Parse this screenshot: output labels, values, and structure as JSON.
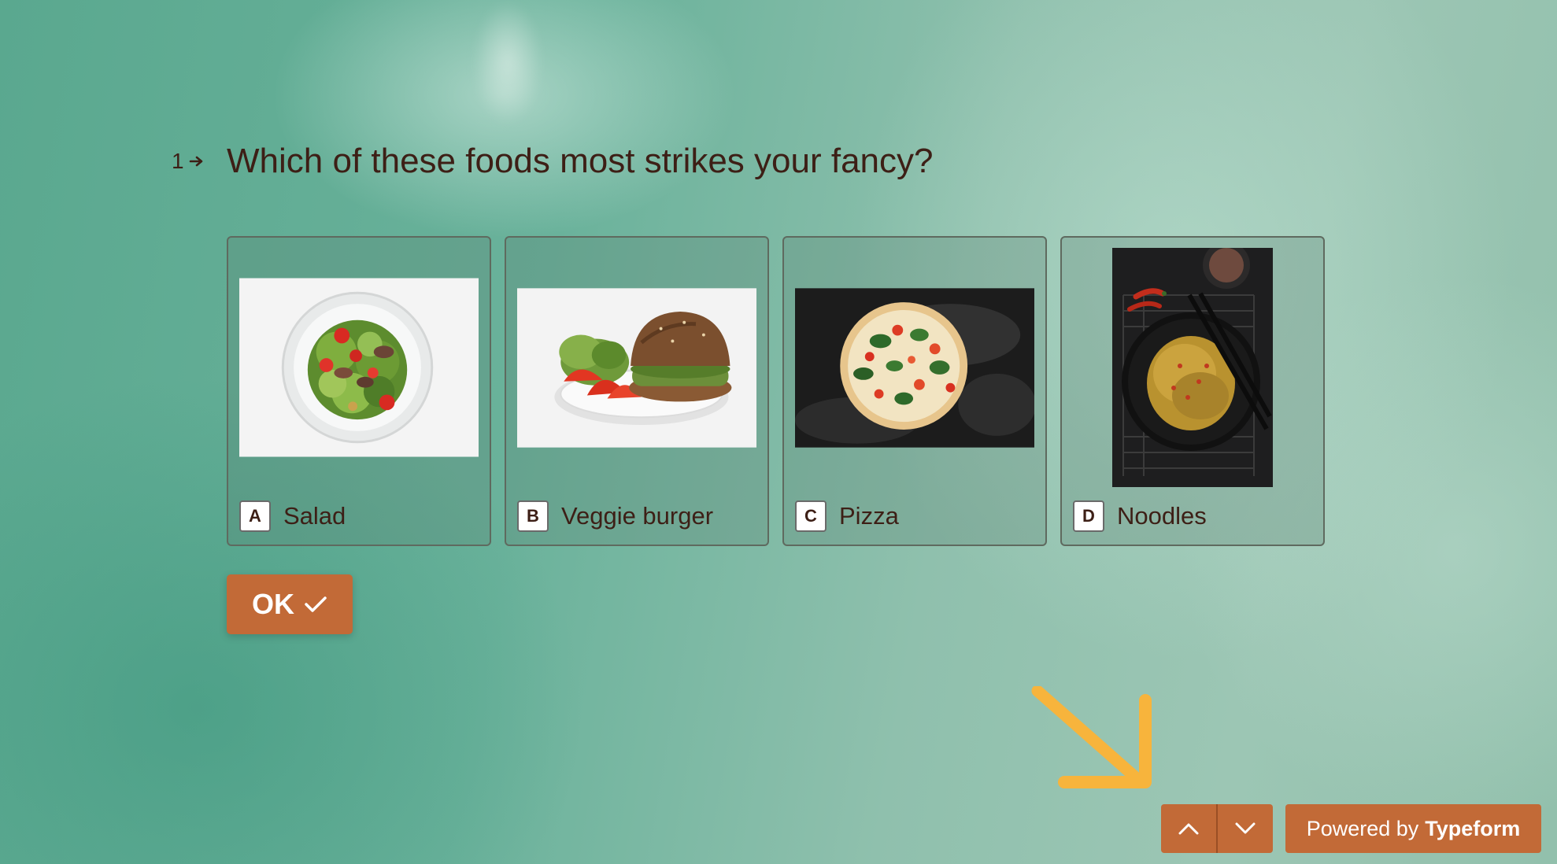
{
  "question": {
    "number": "1",
    "text": "Which of these foods most strikes your fancy?"
  },
  "choices": [
    {
      "key": "A",
      "label": "Salad",
      "image": "salad-photo"
    },
    {
      "key": "B",
      "label": "Veggie burger",
      "image": "veggie-burger-photo"
    },
    {
      "key": "C",
      "label": "Pizza",
      "image": "pizza-photo"
    },
    {
      "key": "D",
      "label": "Noodles",
      "image": "noodles-photo"
    }
  ],
  "ok_button": {
    "label": "OK",
    "icon": "check-icon"
  },
  "navigation": {
    "up_icon": "chevron-up-icon",
    "down_icon": "chevron-down-icon"
  },
  "branding": {
    "prefix": "Powered by",
    "brand": "Typeform"
  },
  "annotation": {
    "icon": "arrow-down-right-icon"
  },
  "colors": {
    "accent": "#c26a37",
    "text": "#3d1f16",
    "annotation_arrow": "#f7b43c",
    "background": "#6fb39d"
  }
}
